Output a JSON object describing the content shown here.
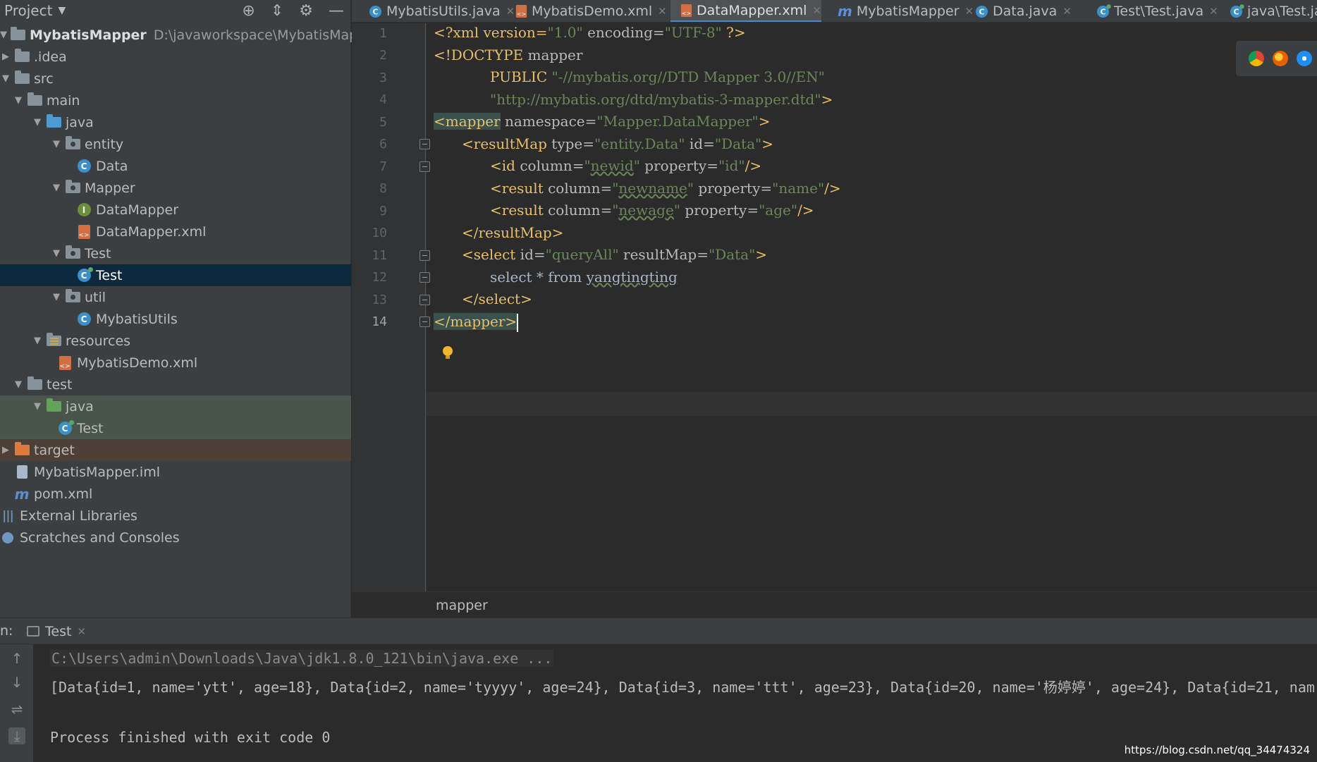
{
  "project_panel": {
    "title": "Project",
    "tree": [
      {
        "label": "MybatisMapper",
        "path": "D:\\javaworkspace\\MybatisMapper",
        "arrow": "▼",
        "icon": "module-icon"
      },
      {
        "label": ".idea",
        "arrow": "▶",
        "icon": "folder-icon"
      },
      {
        "label": "src",
        "arrow": "▼",
        "icon": "folder-icon"
      },
      {
        "label": "main",
        "arrow": "▼",
        "icon": "folder-icon"
      },
      {
        "label": "java",
        "arrow": "▼",
        "icon": "source-folder-icon"
      },
      {
        "label": "entity",
        "arrow": "▼",
        "icon": "package-icon"
      },
      {
        "label": "Data",
        "arrow": "",
        "icon": "class-icon"
      },
      {
        "label": "Mapper",
        "arrow": "▼",
        "icon": "package-icon"
      },
      {
        "label": "DataMapper",
        "arrow": "",
        "icon": "interface-icon"
      },
      {
        "label": "DataMapper.xml",
        "arrow": "",
        "icon": "xml-file-icon"
      },
      {
        "label": "Test",
        "arrow": "▼",
        "icon": "package-icon"
      },
      {
        "label": "Test",
        "arrow": "",
        "icon": "runnable-class-icon"
      },
      {
        "label": "util",
        "arrow": "▼",
        "icon": "package-icon"
      },
      {
        "label": "MybatisUtils",
        "arrow": "",
        "icon": "class-icon"
      },
      {
        "label": "resources",
        "arrow": "▼",
        "icon": "resources-folder-icon"
      },
      {
        "label": "MybatisDemo.xml",
        "arrow": "",
        "icon": "xml-file-icon"
      },
      {
        "label": "test",
        "arrow": "▼",
        "icon": "folder-icon"
      },
      {
        "label": "java",
        "arrow": "▼",
        "icon": "test-source-folder-icon"
      },
      {
        "label": "Test",
        "arrow": "",
        "icon": "runnable-class-icon"
      },
      {
        "label": "target",
        "arrow": "▶",
        "icon": "excluded-folder-icon"
      },
      {
        "label": "MybatisMapper.iml",
        "arrow": "",
        "icon": "iml-file-icon"
      },
      {
        "label": "pom.xml",
        "arrow": "",
        "icon": "maven-icon"
      },
      {
        "label": "External Libraries",
        "arrow": "▶",
        "icon": "libraries-icon"
      },
      {
        "label": "Scratches and Consoles",
        "arrow": "",
        "icon": "scratches-icon"
      }
    ]
  },
  "tabs": [
    {
      "label": "MybatisUtils.java",
      "icon": "class-icon"
    },
    {
      "label": "MybatisDemo.xml",
      "icon": "xml-file-icon"
    },
    {
      "label": "DataMapper.xml",
      "icon": "xml-file-icon",
      "active": true
    },
    {
      "label": "MybatisMapper",
      "icon": "maven-icon"
    },
    {
      "label": "Data.java",
      "icon": "class-icon"
    },
    {
      "label": "Test\\Test.java",
      "icon": "runnable-class-icon"
    },
    {
      "label": "java\\Test.java",
      "icon": "runnable-class-icon"
    }
  ],
  "editor": {
    "line_numbers": [
      "1",
      "2",
      "3",
      "4",
      "5",
      "6",
      "7",
      "8",
      "9",
      "10",
      "11",
      "12",
      "13",
      "14"
    ],
    "current_line": "14",
    "lines": {
      "l1": {
        "a": "<?xml version=",
        "b": "\"1.0\"",
        "c": " encoding=",
        "d": "\"UTF-8\"",
        "e": " ?>"
      },
      "l2": {
        "a": "<!DOCTYPE ",
        "b": "mapper"
      },
      "l3": {
        "a": "PUBLIC ",
        "b": "\"-//mybatis.org//DTD Mapper 3.0//EN\""
      },
      "l4": {
        "a": "\"http://mybatis.org/dtd/mybatis-3-mapper.dtd\"",
        "b": ">"
      },
      "l5": {
        "a": "<mapper",
        "b": " namespace=",
        "c": "\"Mapper.DataMapper\"",
        "d": ">"
      },
      "l6": {
        "a": "<resultMap",
        "b": " type=",
        "c": "\"entity.Data\"",
        "d": " id=",
        "e": "\"Data\"",
        "f": ">"
      },
      "l7": {
        "a": "<id",
        "b": " column=",
        "c": "\"",
        "d": "newid",
        "e": "\"",
        "f": " property=",
        "g": "\"id\"",
        "h": "/>"
      },
      "l8": {
        "a": "<result",
        "b": " column=",
        "c": "\"",
        "d": "newname",
        "e": "\"",
        "f": " property=",
        "g": "\"name\"",
        "h": "/>"
      },
      "l9": {
        "a": "<result",
        "b": " column=",
        "c": "\"",
        "d": "newage",
        "e": "\"",
        "f": " property=",
        "g": "\"age\"",
        "h": "/>"
      },
      "l10": {
        "a": "</resultMap>"
      },
      "l11": {
        "a": "<select",
        "b": " id=",
        "c": "\"queryAll\"",
        "d": " resultMap=",
        "e": "\"Data\"",
        "f": ">"
      },
      "l12": {
        "a": "select * from ",
        "b": "yangtingting"
      },
      "l13": {
        "a": "</select>"
      },
      "l14": {
        "a": "</mapper>"
      }
    },
    "breadcrumb": "mapper"
  },
  "run_panel": {
    "label": "n:",
    "tab": "Test",
    "output": [
      "C:\\Users\\admin\\Downloads\\Java\\jdk1.8.0_121\\bin\\java.exe ...",
      "[Data{id=1, name='ytt', age=18}, Data{id=2, name='tyyyy', age=24}, Data{id=3, name='ttt', age=23}, Data{id=20, name='杨婷婷', age=24}, Data{id=21, nam",
      "Process finished with exit code 0"
    ]
  },
  "watermark": "https://blog.csdn.net/qq_34474324",
  "colors": {
    "background": "#2b2b2b",
    "panel": "#3c3f41",
    "selection": "#0d293e",
    "tag": "#e8bf6a",
    "attribute_value": "#6a8759",
    "accent": "#4a88c7"
  }
}
